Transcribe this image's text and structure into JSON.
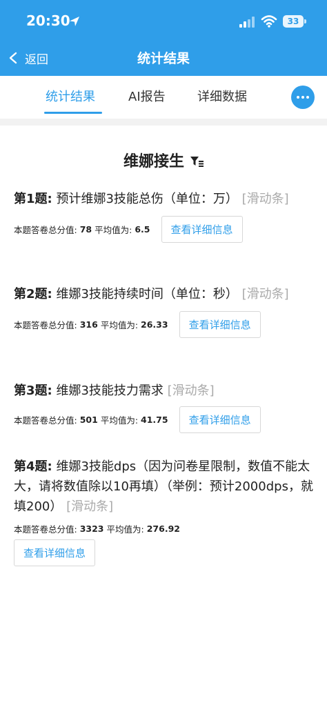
{
  "status_bar": {
    "time": "20:30",
    "battery": "33"
  },
  "nav": {
    "back_label": "返回",
    "title": "统计结果"
  },
  "tabs": [
    {
      "label": "统计结果",
      "active": true
    },
    {
      "label": "AI报告",
      "active": false
    },
    {
      "label": "详细数据",
      "active": false
    }
  ],
  "survey": {
    "title": "维娜接生"
  },
  "questions": [
    {
      "num": "第1题:",
      "text": " 预计维娜3技能总伤（单位：万） ",
      "type": "[滑动条]",
      "total_label": "本题答卷总分值:",
      "total": "78",
      "avg_label": "平均值为:",
      "avg": "6.5",
      "button": "查看详细信息"
    },
    {
      "num": "第2题:",
      "text": " 维娜3技能持续时间（单位：秒） ",
      "type": "[滑动条]",
      "total_label": "本题答卷总分值:",
      "total": "316",
      "avg_label": "平均值为:",
      "avg": "26.33",
      "button": "查看详细信息"
    },
    {
      "num": "第3题:",
      "text": " 维娜3技能技力需求 ",
      "type": "[滑动条]",
      "total_label": "本题答卷总分值:",
      "total": "501",
      "avg_label": "平均值为:",
      "avg": "41.75",
      "button": "查看详细信息"
    },
    {
      "num": "第4题:",
      "text": " 维娜3技能dps（因为问卷星限制，数值不能太大，请将数值除以10再填）（举例：预计2000dps，就填200） ",
      "type": "[滑动条]",
      "total_label": "本题答卷总分值:",
      "total": "3323",
      "avg_label": "平均值为:",
      "avg": "276.92",
      "button": "查看详细信息"
    }
  ],
  "colors": {
    "brand": "#2f9ee9",
    "muted": "#aaaaaa",
    "band": "#f2f2f2"
  },
  "icons": [
    "location-arrow-icon",
    "signal-icon",
    "wifi-icon",
    "battery-icon",
    "chevron-left-icon",
    "more-icon",
    "filter-icon"
  ]
}
